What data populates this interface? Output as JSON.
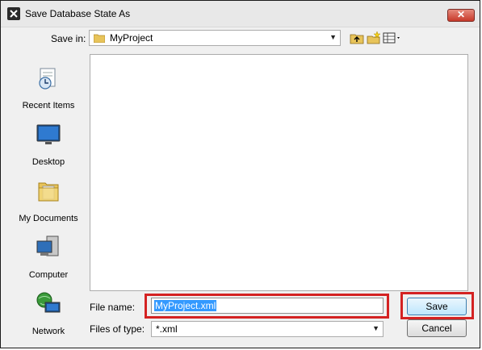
{
  "window": {
    "title": "Save Database State As"
  },
  "toolbar": {
    "save_in_label": "Save in:",
    "save_in_value": "MyProject"
  },
  "places": [
    {
      "label": "Recent Items",
      "icon": "recent-items-icon"
    },
    {
      "label": "Desktop",
      "icon": "desktop-icon"
    },
    {
      "label": "My Documents",
      "icon": "my-documents-icon"
    },
    {
      "label": "Computer",
      "icon": "computer-icon"
    },
    {
      "label": "Network",
      "icon": "network-icon"
    }
  ],
  "form": {
    "file_name_label": "File name:",
    "file_name_value": "MyProject.xml",
    "file_type_label": "Files of type:",
    "file_type_value": "*.xml"
  },
  "buttons": {
    "save": "Save",
    "cancel": "Cancel"
  },
  "colors": {
    "highlight_box": "#d42222",
    "selection": "#3399ff"
  }
}
